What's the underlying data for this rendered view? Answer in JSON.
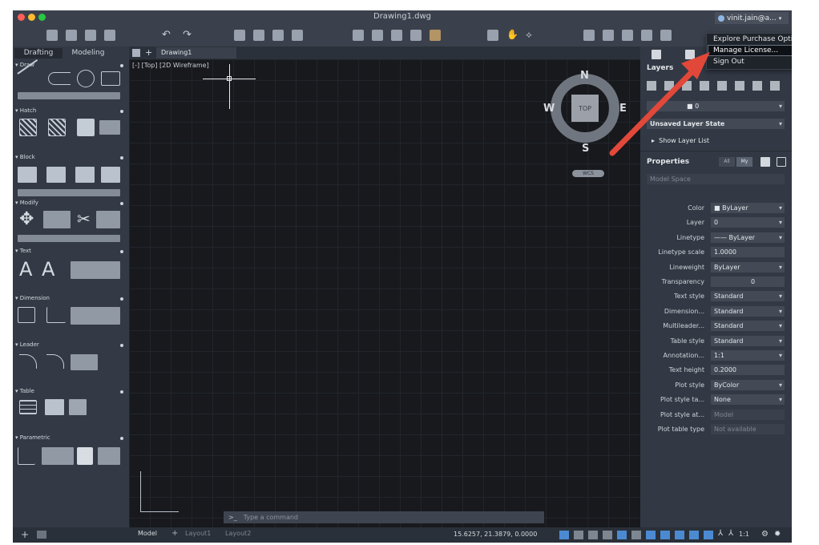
{
  "window": {
    "title": "Drawing1.dwg",
    "user": "vinit.jain@a..."
  },
  "account_menu": {
    "items": [
      "Explore Purchase Options",
      "Manage License...",
      "Sign Out"
    ]
  },
  "palette": {
    "tabs": [
      "Drafting",
      "Modeling"
    ],
    "sections": [
      "Draw",
      "Hatch",
      "Block",
      "Modify",
      "Text",
      "Dimension",
      "Leader",
      "Table",
      "Parametric"
    ]
  },
  "document": {
    "tab": "Drawing1",
    "view_label": "[-] [Top] [2D Wireframe]"
  },
  "viewcube": {
    "n": "N",
    "s": "S",
    "e": "E",
    "w": "W",
    "face": "TOP",
    "wcs": "WCS"
  },
  "command_line": {
    "placeholder": "Type a command",
    "prompt": ">_"
  },
  "status": {
    "layouts": [
      "Model",
      "Layout1",
      "Layout2"
    ],
    "coords": "15.6257, 21.3879, 0.0000",
    "scale": "1:1"
  },
  "layers": {
    "title": "Layers",
    "current_layer": "0",
    "layer_state": "Unsaved Layer State",
    "show_list": "Show Layer List"
  },
  "properties": {
    "title": "Properties",
    "filters": [
      "All",
      "My"
    ],
    "space": "Model Space",
    "rows": [
      {
        "label": "Color",
        "value": "ByLayer"
      },
      {
        "label": "Layer",
        "value": "0"
      },
      {
        "label": "Linetype",
        "value": "ByLayer"
      },
      {
        "label": "Linetype scale",
        "value": "1.0000"
      },
      {
        "label": "Lineweight",
        "value": "ByLayer"
      },
      {
        "label": "Transparency",
        "value": "0"
      },
      {
        "label": "Text style",
        "value": "Standard"
      },
      {
        "label": "Dimension...",
        "value": "Standard"
      },
      {
        "label": "Multileader...",
        "value": "Standard"
      },
      {
        "label": "Table style",
        "value": "Standard"
      },
      {
        "label": "Annotation...",
        "value": "1:1"
      },
      {
        "label": "Text height",
        "value": "0.2000"
      },
      {
        "label": "Plot style",
        "value": "ByColor"
      },
      {
        "label": "Plot style ta...",
        "value": "None"
      },
      {
        "label": "Plot style at...",
        "value": "Model"
      },
      {
        "label": "Plot table type",
        "value": "Not available"
      }
    ]
  },
  "colors": {
    "accent_arrow": "#e2483a",
    "canvas": "#17191d"
  }
}
